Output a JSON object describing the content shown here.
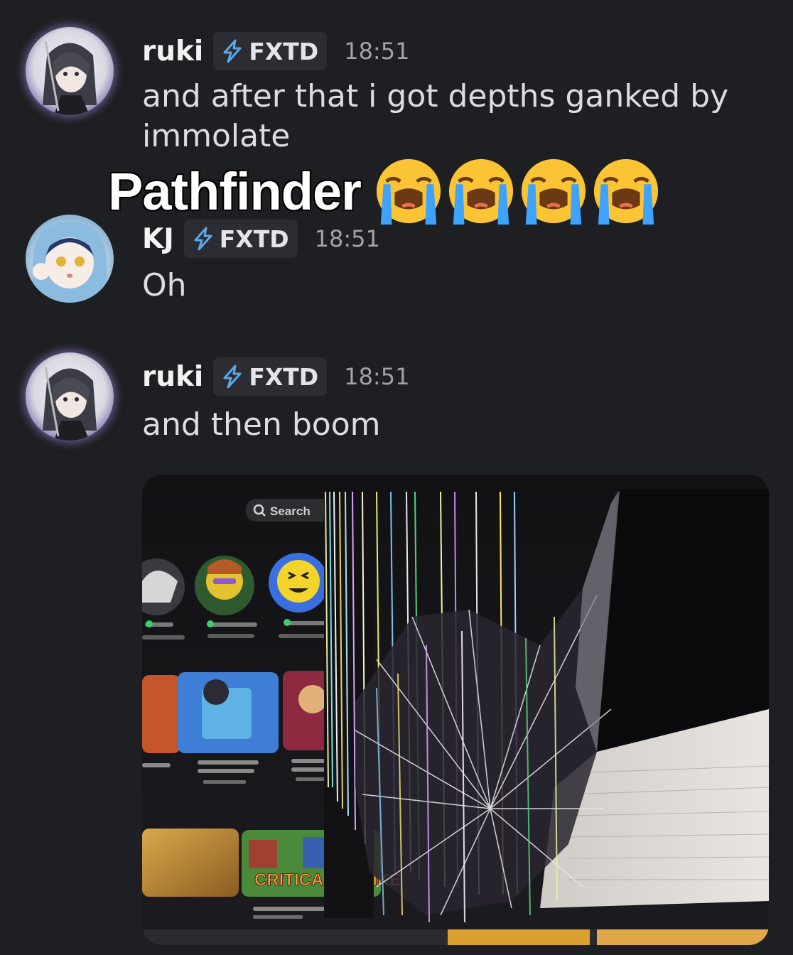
{
  "overlay": {
    "caption": "Pathfinder",
    "emoji_name": "loudly-crying-face",
    "emoji_count": 4
  },
  "messages": [
    {
      "username": "ruki",
      "tag": "FXTD",
      "time": "18:51",
      "text": "and after that i got depths ganked by immolate",
      "avatar": "ruki-avatar"
    },
    {
      "username": "KJ",
      "tag": "FXTD",
      "time": "18:51",
      "text": "Oh",
      "avatar": "kj-avatar"
    },
    {
      "username": "ruki",
      "tag": "FXTD",
      "time": "18:51",
      "text": "and then boom",
      "avatar": "ruki-avatar"
    }
  ],
  "attachment": {
    "search_label": "Search",
    "game_banner": "CRITICAL STRIKE",
    "tag_icon": "lightning-bolt-icon"
  },
  "colors": {
    "background": "#1e1f22",
    "tag_bg": "#2b2d33",
    "lightning": "#5aa9e6"
  }
}
